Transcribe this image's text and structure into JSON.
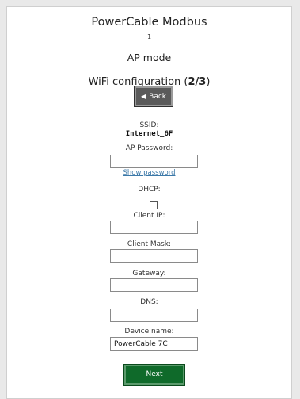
{
  "header": {
    "title": "PowerCable Modbus",
    "device_number": "1",
    "mode": "AP mode",
    "wifi_prefix": "WiFi configuration (",
    "wifi_step": "2/3",
    "wifi_suffix": ")"
  },
  "back_button": {
    "label": "Back",
    "icon": "triangle-left-icon"
  },
  "ssid": {
    "label": "SSID:",
    "value": "Internet_6F"
  },
  "ap_password": {
    "label": "AP Password:",
    "value": ""
  },
  "show_password": "Show password",
  "dhcp": {
    "label": "DHCP:",
    "checked": false
  },
  "client_ip": {
    "label": "Client IP:",
    "value": ""
  },
  "client_mask": {
    "label": "Client Mask:",
    "value": ""
  },
  "gateway": {
    "label": "Gateway:",
    "value": ""
  },
  "dns": {
    "label": "DNS:",
    "value": ""
  },
  "device_name": {
    "label": "Device name:",
    "value": "PowerCable 7C"
  },
  "next_button": {
    "label": "Next"
  },
  "colors": {
    "back_button": "#5a5a5a",
    "next_button": "#0f6a2a",
    "link": "#3b78a8"
  }
}
